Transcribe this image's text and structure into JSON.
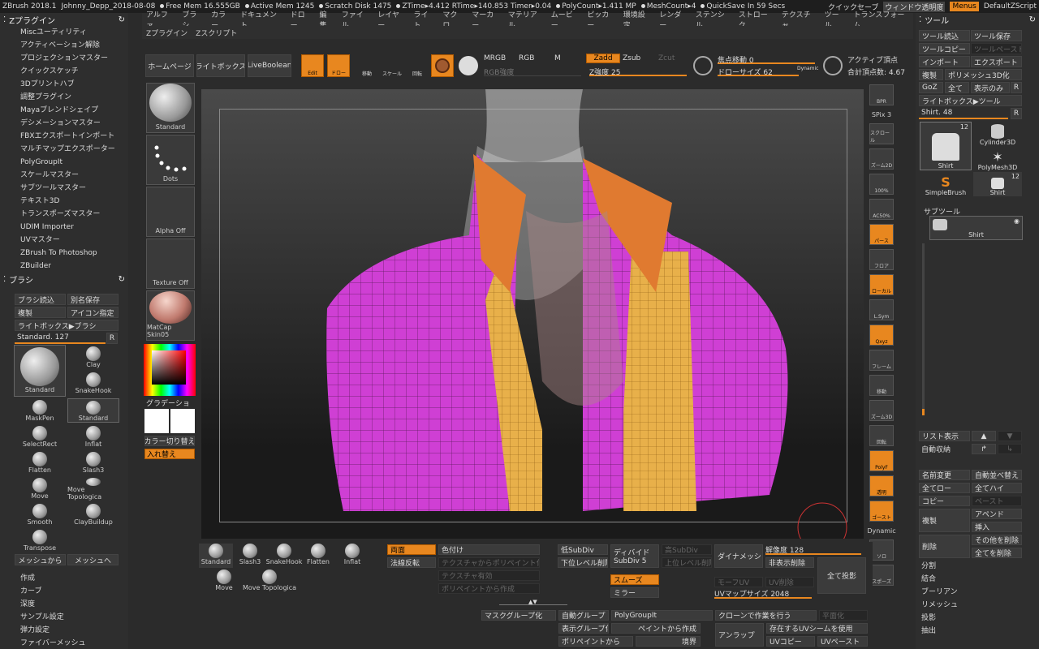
{
  "topbar": {
    "app": "ZBrush 2018.1",
    "project": "Johnny_Depp_2018-08-08",
    "free_mem": "Free Mem 16.555GB",
    "active_mem": "Active Mem 1245",
    "scratch": "Scratch Disk 1475",
    "ztime": "ZTime▸4.412 RTime▸140.853 Timer▸0.04",
    "polycount": "PolyCount▸1.411 MP",
    "meshcount": "MeshCount▸4",
    "quicksave": "QuickSave In 59 Secs",
    "quick_save_btn": "クイックセーブ",
    "window_trans": "ウィンドウ透明度",
    "menus": "Menus",
    "script": "DefaultZScript"
  },
  "menus": [
    "アルファ",
    "ブラシ",
    "カラー",
    "ドキュメント",
    "ドロー",
    "編集",
    "ファイル",
    "レイヤー",
    "ライト",
    "マクロ",
    "マーカー",
    "マテリアル",
    "ムービー",
    "ピッカー",
    "環境設定",
    "レンダー",
    "ステンシル",
    "ストローク",
    "テクスチャ",
    "ツール",
    "トランスフォーム"
  ],
  "menus2": [
    "Zプラグイン",
    "Zスクリプト"
  ],
  "left": {
    "plugin_title": "Zプラグイン",
    "plugins": [
      "Miscユーティリティ",
      "アクティベーション解除",
      "プロジェクションマスター",
      "クイックスケッチ",
      "3Dプリントハブ",
      "調整プラグイン",
      "Mayaブレンドシェイプ",
      "デシメーションマスター",
      "FBXエクスポートインポート",
      "マルチマップエクスポーター",
      "PolyGroupIt",
      "スケールマスター",
      "サブツールマスター",
      "テキスト3D",
      "トランスポーズマスター",
      "UDIM Importer",
      "UVマスター",
      "ZBrush To Photoshop",
      "ZBuilder"
    ],
    "brush_title": "ブラシ",
    "brush_load": "ブラシ読込",
    "save_as": "別名保存",
    "copy": "複製",
    "icon": "アイコン指定",
    "lightbox": "ライトボックス▶ブラシ",
    "current": "Standard. 127",
    "r": "R",
    "brushes": [
      "Standard",
      "Clay",
      "SnakeHook",
      "MaskPen",
      "Standard",
      "SelectRect",
      "Inflat",
      "Flatten",
      "Slash3",
      "Move",
      "Move Topologica",
      "Smooth",
      "ClayBuildup",
      "Transpose"
    ],
    "mesh_from": "メッシュから",
    "mesh_to": "メッシュへ",
    "bottom_items": [
      "作成",
      "カーブ",
      "深度",
      "サンプル設定",
      "弾力設定",
      "ファイバーメッシュ"
    ]
  },
  "mid": {
    "standard": "Standard",
    "dots": "Dots",
    "alpha": "Alpha Off",
    "texture": "Texture Off",
    "matcap": "MatCap Skin05",
    "gradient": "グラデーション",
    "swap": "カラー切り替え",
    "replace": "入れ替え"
  },
  "toolbar": {
    "home": "ホームページ",
    "lightbox": "ライトボックス",
    "liveboolean": "LiveBoolean",
    "edit": "Edit",
    "draw": "ドロー",
    "move": "移動",
    "scale": "スケール",
    "rotate": "回転",
    "mrgb": "MRGB",
    "rgb": "RGB",
    "m": "M",
    "zadd": "Zadd",
    "zsub": "Zsub",
    "zcut": "Zcut",
    "rgb_strength": "RGB強度",
    "z_strength": "Z強度 25",
    "focal": "焦点移動 0",
    "draw_size": "ドローサイズ 62",
    "dynamic": "Dynamic",
    "active_points": "アクティブ頂点",
    "total_points": "合計頂点数: 4.67"
  },
  "shelf": [
    "BPR",
    "SPix 3",
    "スクロール",
    "ズーム2D",
    "100%",
    "AC50%",
    "パース",
    "フロア",
    "ローカル",
    "L.Sym",
    "Qxyz",
    "フレーム",
    "移動",
    "ズーム3D",
    "回転",
    "PolyF",
    "透明",
    "ゴースト",
    "Dynamic",
    "ソロ",
    "スポーズ"
  ],
  "right": {
    "title": "ツール",
    "load": "ツール読込",
    "save": "ツール保存",
    "copy": "ツールコピー",
    "paste": "ツールペースト",
    "import": "インポート",
    "export": "エクスポート",
    "dup": "複製",
    "polymesh": "ポリメッシュ3D化",
    "goz": "GoZ",
    "all": "全て",
    "show": "表示のみ",
    "r": "R",
    "lightbox": "ライトボックス▶ツール",
    "shirt": "Shirt. 48",
    "tools": [
      "Shirt",
      "Cylinder3D",
      "PolyMesh3D",
      "SimpleBrush",
      "Shirt"
    ],
    "count12": "12",
    "subtool": "サブツール",
    "subtool_name": "Shirt",
    "list": "リスト表示",
    "autocollapse": "自動収納",
    "rename": "名前変更",
    "autoreorder": "自動並べ替え",
    "alllow": "全てロー",
    "allhigh": "全てハイ",
    "copy2": "コピー",
    "paste2": "ペースト",
    "dup2": "複製",
    "append": "アペンド",
    "insert": "挿入",
    "delete": "削除",
    "delother": "その他を削除",
    "delall": "全てを削除",
    "items": [
      "分割",
      "結合",
      "ブーリアン",
      "リメッシュ",
      "投影",
      "抽出"
    ]
  },
  "bottom": {
    "brushes": [
      "Standard",
      "Slash3",
      "SnakeHook",
      "Flatten",
      "Inflat",
      "Move",
      "Move Topologica"
    ],
    "double": "両面",
    "flip": "法線反転",
    "fill": "色付け",
    "tex_poly": "テクスチャからポリペイント化",
    "tex_on": "テクスチャ有効",
    "poly_make": "ポリペイントから作成",
    "low_sub": "低SubDiv",
    "del_lower": "下位レベル削除",
    "divide": "ディバイド",
    "subdiv": "SubDiv 5",
    "high_sub": "高SubDiv",
    "del_higher": "上位レベル削除",
    "smooth": "スムーズ",
    "mirror": "ミラー",
    "dynamesh": "ダイナメッシュ",
    "resolution": "解像度 128",
    "del_hidden": "非表示削除",
    "proj_all": "全て投影",
    "morph_uv": "モーフUV",
    "uv_del": "UV削除",
    "uv_size": "UVマップサイズ 2048",
    "mask_group": "マスクグループ化",
    "auto_group": "自動グループ",
    "polygroupit": "PolyGroupIt",
    "clone": "クローンで作業を行う",
    "flat": "平面化",
    "vis_group": "表示グループ化",
    "paint_create": "ペイントから作成",
    "poly_from": "ポリペイントから",
    "border": "境界",
    "unwrap": "アンラップ",
    "uv_seam": "存在するUVシームを使用",
    "uv_copy": "UVコピー",
    "uv_paste": "UVペースト"
  },
  "colors": {
    "orange": "#e8871f",
    "bg": "#2b2b2b"
  }
}
